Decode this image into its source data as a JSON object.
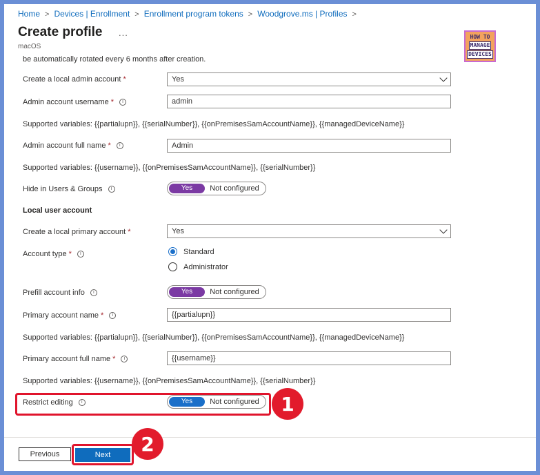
{
  "breadcrumb": [
    "Home",
    "Devices | Enrollment",
    "Enrollment program tokens",
    "Woodgrove.ms | Profiles"
  ],
  "header": {
    "title": "Create profile",
    "more": "...",
    "subtitle": "macOS"
  },
  "logo": {
    "line1": "HOW TO",
    "line2": "MANAGE",
    "line3": "DEVICES"
  },
  "form": {
    "rotated_note": "be automatically rotated every 6 months after creation.",
    "local_admin": {
      "label": "Create a local admin account",
      "value": "Yes"
    },
    "admin_username": {
      "label": "Admin account username",
      "value": "admin"
    },
    "admin_username_vars": "Supported variables: {{partialupn}}, {{serialNumber}}, {{onPremisesSamAccountName}}, {{managedDeviceName}}",
    "admin_fullname": {
      "label": "Admin account full name",
      "value": "Admin"
    },
    "admin_fullname_vars": "Supported variables: {{username}}, {{onPremisesSamAccountName}}, {{serialNumber}}",
    "hide_users": {
      "label": "Hide in Users & Groups",
      "on": "Yes",
      "off": "Not configured"
    },
    "section_local_user": "Local user account",
    "local_primary": {
      "label": "Create a local primary account",
      "value": "Yes"
    },
    "account_type": {
      "label": "Account type",
      "options": [
        "Standard",
        "Administrator"
      ],
      "selected": "Standard"
    },
    "prefill": {
      "label": "Prefill account info",
      "on": "Yes",
      "off": "Not configured"
    },
    "primary_name": {
      "label": "Primary account name",
      "value": "{{partialupn}}"
    },
    "primary_name_vars": "Supported variables: {{partialupn}}, {{serialNumber}}, {{onPremisesSamAccountName}}, {{managedDeviceName}}",
    "primary_fullname": {
      "label": "Primary account full name",
      "value": "{{username}}"
    },
    "primary_fullname_vars": "Supported variables: {{username}}, {{onPremisesSamAccountName}}, {{serialNumber}}",
    "restrict": {
      "label": "Restrict editing",
      "on": "Yes",
      "off": "Not configured"
    },
    "required_mark": "*",
    "info_glyph": "i"
  },
  "annotations": {
    "badge1": "1",
    "badge2": "2"
  },
  "footer": {
    "previous": "Previous",
    "next": "Next"
  },
  "colors": {
    "accent": "#0f6cbd",
    "toggle_purple": "#7b3aa3",
    "toggle_blue": "#1a6fc9",
    "annotation_red": "#e21b2c",
    "frame_border": "#6b8fd6"
  }
}
